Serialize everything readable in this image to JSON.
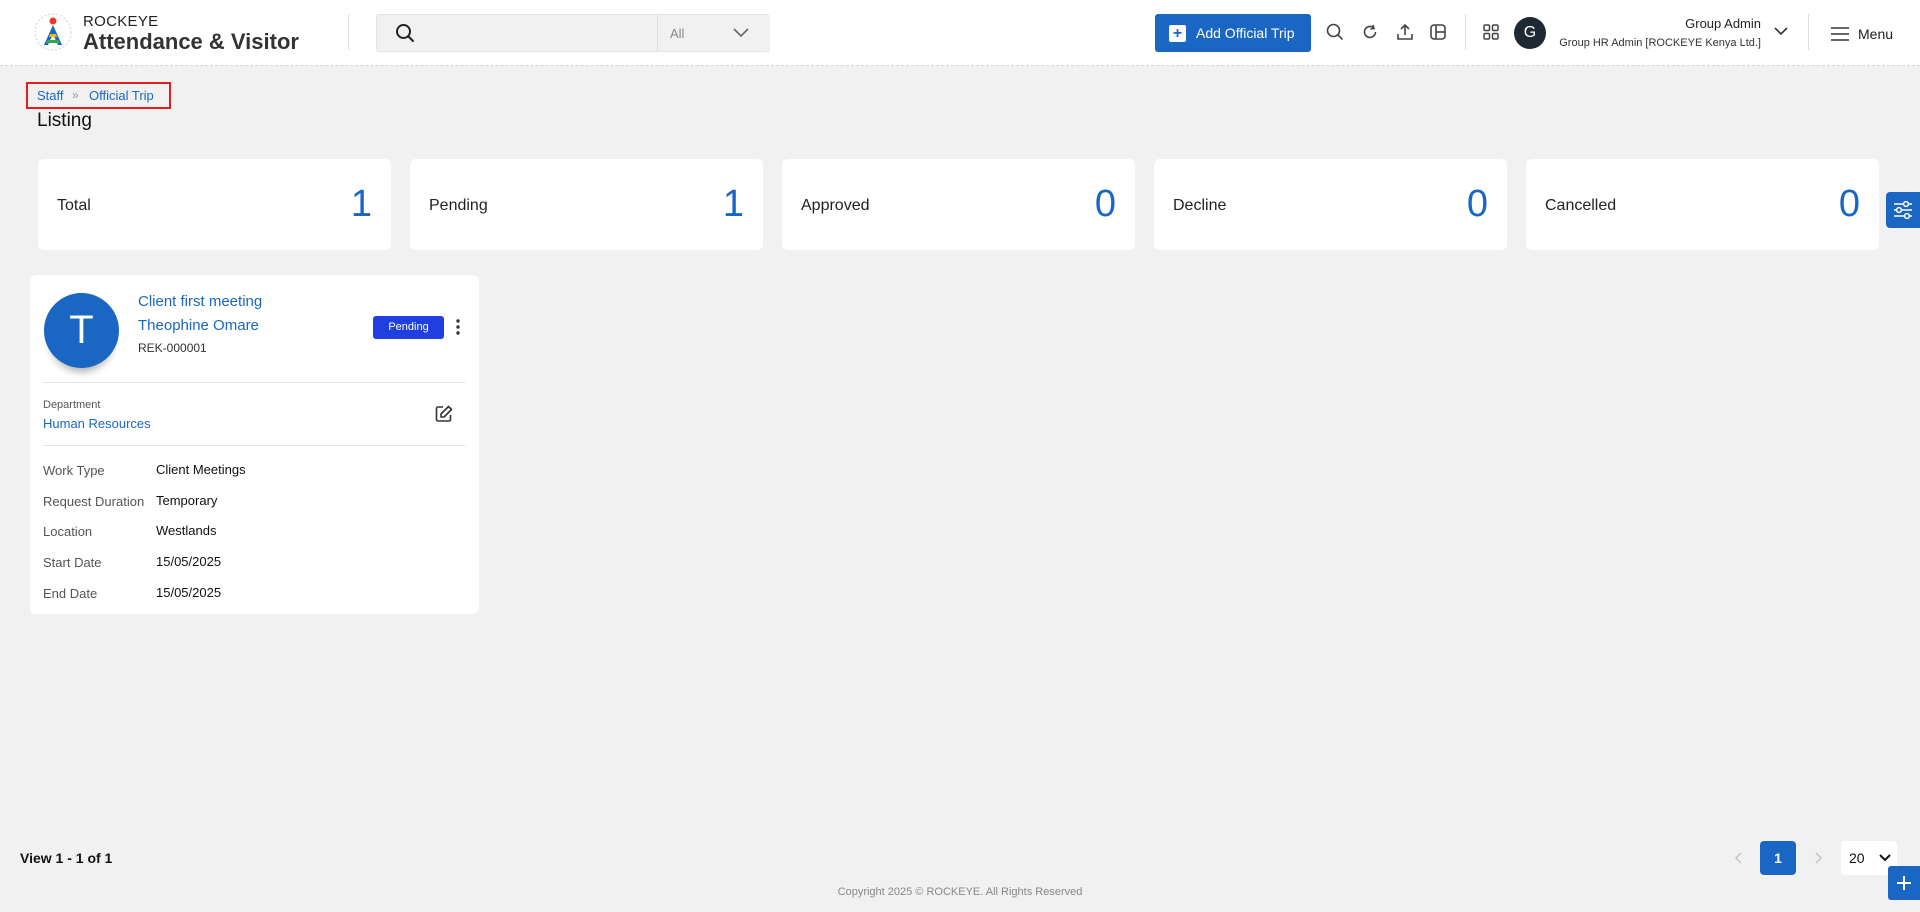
{
  "header": {
    "brand_top": "ROCKEYE",
    "brand_main": "Attendance & Visitor",
    "search": {
      "value": "",
      "placeholder": "",
      "filter_selected": "All"
    },
    "add_button_label": "Add Official Trip",
    "avatar_initial": "G",
    "user_name": "Group Admin",
    "user_role": "Group HR Admin [ROCKEYE Kenya Ltd.]",
    "menu_label": "Menu",
    "icons": [
      "search-icon",
      "refresh-icon",
      "upload-icon",
      "layout-icon",
      "apps-grid-icon",
      "hamburger-icon",
      "chevron-down-icon"
    ]
  },
  "breadcrumb": {
    "items": [
      "Staff",
      "Official Trip"
    ]
  },
  "page_title": "Listing",
  "stats": [
    {
      "label": "Total",
      "value": "1"
    },
    {
      "label": "Pending",
      "value": "1"
    },
    {
      "label": "Approved",
      "value": "0"
    },
    {
      "label": "Decline",
      "value": "0"
    },
    {
      "label": "Cancelled",
      "value": "0"
    }
  ],
  "trip_card": {
    "avatar_initial": "T",
    "title": "Client first meeting",
    "employee_name": "Theophine Omare",
    "employee_id": "REK-000001",
    "status": "Pending",
    "department_label": "Department",
    "department": "Human Resources",
    "details": [
      {
        "label": "Work Type",
        "value": "Client Meetings"
      },
      {
        "label": "Request Duration",
        "value": "Temporary"
      },
      {
        "label": "Location",
        "value": "Westlands"
      },
      {
        "label": "Start Date",
        "value": "15/05/2025"
      },
      {
        "label": "End Date",
        "value": "15/05/2025"
      }
    ]
  },
  "footer": {
    "view_info": "View 1 - 1 of 1",
    "copyright": "Copyright 2025 © ROCKEYE. All Rights Reserved",
    "current_page": "1",
    "page_size": "20"
  },
  "colors": {
    "accent": "#1967c2",
    "badge": "#1f3fe0",
    "breadcrumb_highlight": "#e02020",
    "background": "#f1f1f1"
  }
}
